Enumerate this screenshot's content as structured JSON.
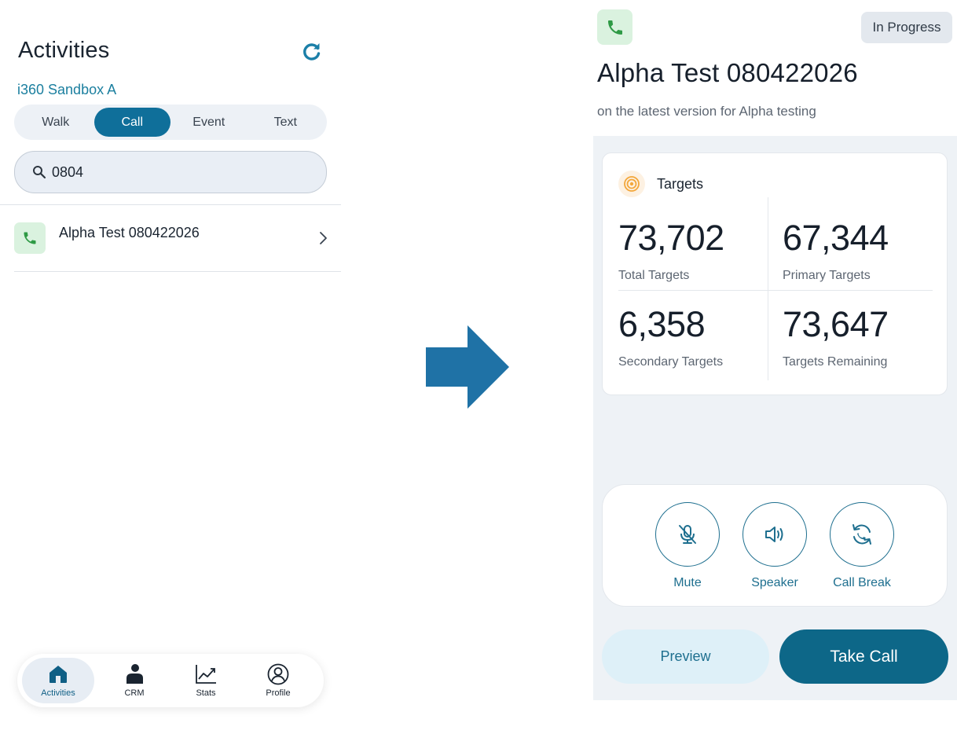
{
  "left_screen": {
    "title": "Activities",
    "org_name": "i360 Sandbox A",
    "segments": [
      {
        "label": "Walk",
        "active": false
      },
      {
        "label": "Call",
        "active": true
      },
      {
        "label": "Event",
        "active": false
      },
      {
        "label": "Text",
        "active": false
      }
    ],
    "search": {
      "value": "0804",
      "icon": "search-icon"
    },
    "list": [
      {
        "title": "Alpha Test 080422026",
        "icon": "phone-icon"
      }
    ],
    "bottom_nav": [
      {
        "label": "Activities",
        "icon": "home-icon",
        "active": true
      },
      {
        "label": "CRM",
        "icon": "person-icon",
        "active": false
      },
      {
        "label": "Stats",
        "icon": "stats-icon",
        "active": false
      },
      {
        "label": "Profile",
        "icon": "profile-icon",
        "active": false
      }
    ]
  },
  "right_screen": {
    "status": "In Progress",
    "title": "Alpha Test 080422026",
    "subtitle": "on the latest version for Alpha testing",
    "targets": {
      "label": "Targets",
      "stats": [
        {
          "value": "73,702",
          "label": "Total Targets"
        },
        {
          "value": "67,344",
          "label": "Primary Targets"
        },
        {
          "value": "6,358",
          "label": "Secondary Targets"
        },
        {
          "value": "73,647",
          "label": "Targets Remaining"
        }
      ]
    },
    "controls": [
      {
        "label": "Mute",
        "icon": "mic-off-icon"
      },
      {
        "label": "Speaker",
        "icon": "speaker-icon"
      },
      {
        "label": "Call Break",
        "icon": "call-break-icon"
      }
    ],
    "preview_label": "Preview",
    "take_call_label": "Take Call"
  },
  "colors": {
    "accent": "#0f6f9a",
    "accent_dark": "#0d6788",
    "org_text": "#1b7f9f",
    "phone_green": "#2e9a45",
    "phone_bg": "#daf2df",
    "arrow": "#1f72a6",
    "target_orange": "#f3a73b"
  }
}
